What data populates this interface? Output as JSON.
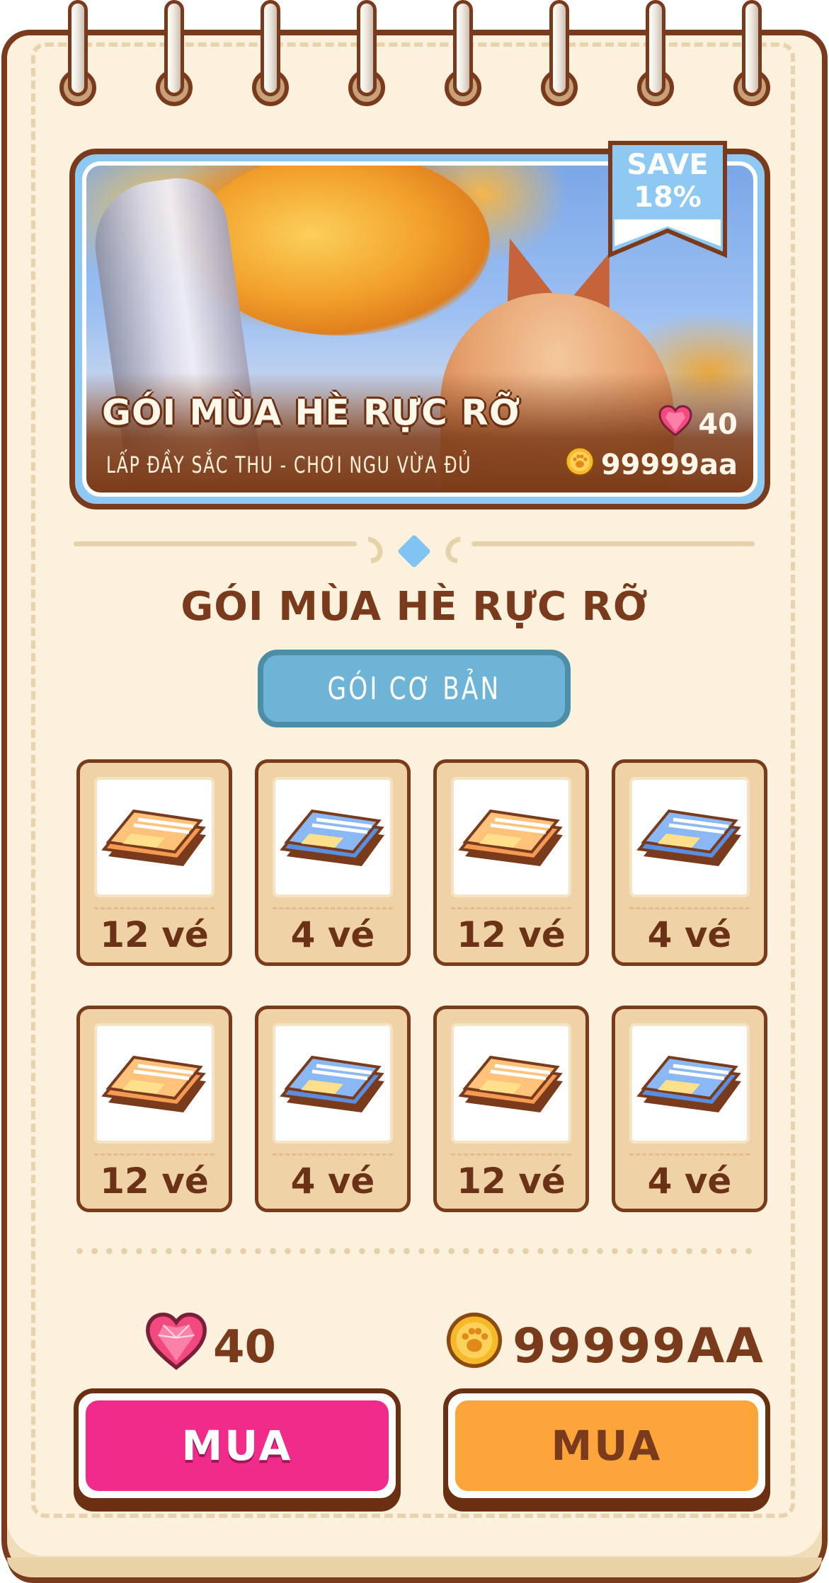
{
  "banner": {
    "title": "GÓI MÙA HÈ RỰC RỠ",
    "subtitle": "LẤP ĐẦY SẮC THU - CHƠI NGU VỪA ĐỦ",
    "hearts_price": "40",
    "coins_price": "99999aa",
    "save_label_line1": "SAVE",
    "save_label_line2": "18%"
  },
  "pack": {
    "title": "GÓI MÙA HÈ RỰC RỠ",
    "tab_label": "GÓI CƠ BẢN"
  },
  "items": [
    {
      "label": "12 vé",
      "ticket": "orange-ticket-icon"
    },
    {
      "label": "4 vé",
      "ticket": "blue-ticket-icon"
    },
    {
      "label": "12 vé",
      "ticket": "orange-ticket-icon"
    },
    {
      "label": "4 vé",
      "ticket": "blue-ticket-icon"
    },
    {
      "label": "12 vé",
      "ticket": "orange-ticket-icon"
    },
    {
      "label": "4 vé",
      "ticket": "blue-ticket-icon"
    },
    {
      "label": "12 vé",
      "ticket": "orange-ticket-icon"
    },
    {
      "label": "4 vé",
      "ticket": "blue-ticket-icon"
    }
  ],
  "purchase": {
    "hearts_price": "40",
    "coins_price": "99999AA",
    "buy_hearts_label": "MUA",
    "buy_coins_label": "MUA"
  },
  "colors": {
    "brown_outline": "#7a3a1c",
    "paper": "#fbf1dc",
    "pink_button": "#f02b89",
    "orange_button": "#fba53a",
    "tab_blue": "#6eb4d6",
    "ribbon_blue": "#8dc9f2"
  }
}
